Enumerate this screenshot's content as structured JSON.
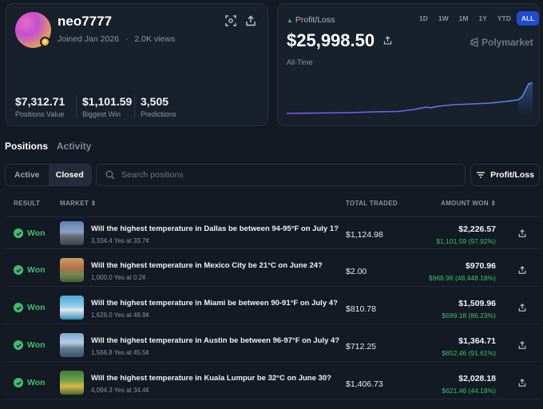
{
  "profile": {
    "username": "neo7777",
    "joined": "Joined Jan 2026",
    "views": "2.0K views",
    "stats": [
      {
        "value": "$7,312.71",
        "label": "Positions Value"
      },
      {
        "value": "$1,101.59",
        "label": "Biggest Win"
      },
      {
        "value": "3,505",
        "label": "Predictions"
      }
    ]
  },
  "pnl": {
    "label": "Profit/Loss",
    "value": "$25,998.50",
    "brand": "Polymarket",
    "period": "All-Time",
    "ranges": [
      "1D",
      "1W",
      "1M",
      "1Y",
      "YTD",
      "ALL"
    ],
    "active_range": "ALL",
    "line_color": "#7b5cf0"
  },
  "tabs": {
    "positions": "Positions",
    "activity": "Activity"
  },
  "filter": {
    "active": "Active",
    "closed": "Closed"
  },
  "search": {
    "placeholder": "Search positions"
  },
  "sort_button": "Profit/Loss",
  "table": {
    "headers": {
      "result": "RESULT",
      "market": "MARKET",
      "total": "TOTAL TRADED",
      "won": "AMOUNT WON"
    },
    "rows": [
      {
        "result": "Won",
        "question": "Will the highest temperature in Dallas be between 94-95°F on July 1?",
        "sub": "3,334.4 Yes at 33.7¢",
        "traded": "$1,124.98",
        "won": "$2,226.57",
        "won_sub": "$1,101.59 (97.92%)"
      },
      {
        "result": "Won",
        "question": "Will the highest temperature in Mexico City be 21°C on June 24?",
        "sub": "1,000.0 Yes at 0.2¢",
        "traded": "$2.00",
        "won": "$970.96",
        "won_sub": "$968.96 (48,448.18%)"
      },
      {
        "result": "Won",
        "question": "Will the highest temperature in Miami be between 90-91°F on July 4?",
        "sub": "1,626.0 Yes at 49.9¢",
        "traded": "$810.78",
        "won": "$1,509.96",
        "won_sub": "$699.18 (86.23%)"
      },
      {
        "result": "Won",
        "question": "Will the highest temperature in Austin be between 96-97°F on July 4?",
        "sub": "1,566.8 Yes at 45.5¢",
        "traded": "$712.25",
        "won": "$1,364.71",
        "won_sub": "$652.46 (91.61%)"
      },
      {
        "result": "Won",
        "question": "Will the highest temperature in Kuala Lumpur be 32°C on June 30?",
        "sub": "4,094.3 Yes at 34.4¢",
        "traded": "$1,406.73",
        "won": "$2,028.18",
        "won_sub": "$621.46 (44.18%)"
      }
    ]
  }
}
